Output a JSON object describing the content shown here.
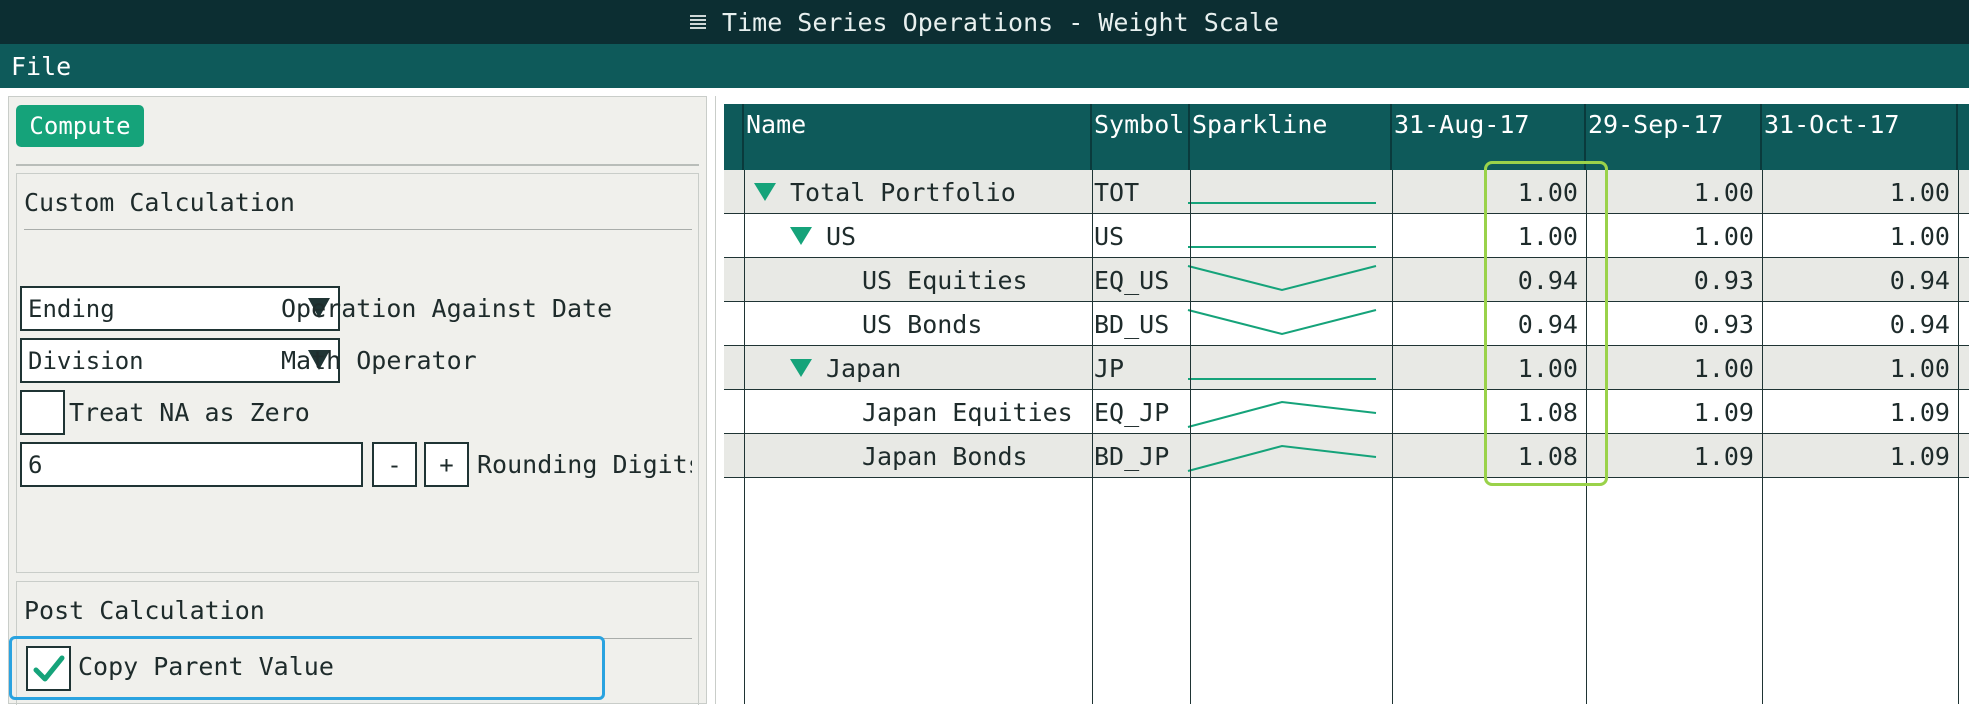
{
  "window": {
    "title": "Time Series Operations - Weight Scale"
  },
  "menu": {
    "file": "File"
  },
  "left_panel": {
    "compute_label": "Compute",
    "custom_calc": {
      "title": "Custom Calculation",
      "operation_select": "Ending",
      "operation_label": "Operation Against Date",
      "math_select": "Division",
      "math_label": "Math Operator",
      "treat_na_label": "Treat NA as Zero",
      "treat_na_checked": false,
      "rounding_value": "6",
      "minus_label": "-",
      "plus_label": "+",
      "rounding_label": "Rounding Digits"
    },
    "post_calc": {
      "title": "Post Calculation",
      "copy_parent_label": "Copy Parent Value",
      "copy_parent_checked": true
    }
  },
  "grid": {
    "columns": [
      "Name",
      "Symbol",
      "Sparkline",
      "31-Aug-17",
      "29-Sep-17",
      "31-Oct-17"
    ],
    "rows": [
      {
        "name": "Total Portfolio",
        "level": 0,
        "expandable": true,
        "symbol": "TOT",
        "values": [
          "1.00",
          "1.00",
          "1.00"
        ],
        "spark": "flat"
      },
      {
        "name": "US",
        "level": 1,
        "expandable": true,
        "symbol": "US",
        "values": [
          "1.00",
          "1.00",
          "1.00"
        ],
        "spark": "flat"
      },
      {
        "name": "US Equities",
        "level": 2,
        "expandable": false,
        "symbol": "EQ_US",
        "values": [
          "0.94",
          "0.93",
          "0.94"
        ],
        "spark": "valley"
      },
      {
        "name": "US Bonds",
        "level": 2,
        "expandable": false,
        "symbol": "BD_US",
        "values": [
          "0.94",
          "0.93",
          "0.94"
        ],
        "spark": "valley"
      },
      {
        "name": "Japan",
        "level": 1,
        "expandable": true,
        "symbol": "JP",
        "values": [
          "1.00",
          "1.00",
          "1.00"
        ],
        "spark": "flat"
      },
      {
        "name": "Japan Equities",
        "level": 2,
        "expandable": false,
        "symbol": "EQ_JP",
        "values": [
          "1.08",
          "1.09",
          "1.09"
        ],
        "spark": "peak"
      },
      {
        "name": "Japan Bonds",
        "level": 2,
        "expandable": false,
        "symbol": "BD_JP",
        "values": [
          "1.08",
          "1.09",
          "1.09"
        ],
        "spark": "peak"
      }
    ]
  },
  "colors": {
    "title_bar": "#0c2e32",
    "menu_bar": "#0e5a5a",
    "accent": "#15a37a",
    "focus_highlight": "#2aa3e0",
    "column_highlight": "#9ad24a"
  }
}
